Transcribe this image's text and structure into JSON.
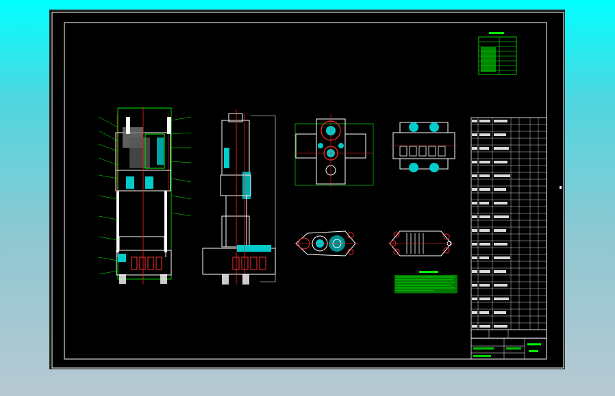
{
  "drawing": {
    "title_block_name_label": "",
    "title_block_number_label": "",
    "notes_header": "",
    "specs_header": ""
  },
  "colors": {
    "frame": "#ffffff",
    "linework": "#ffffff",
    "dimension": "#00ff00",
    "hatch": "#00cccc",
    "centerline": "#ff2020",
    "section": "#ffff00",
    "background": "#000000"
  },
  "icons": [
    "drawing-frame",
    "title-block",
    "parts-list"
  ]
}
